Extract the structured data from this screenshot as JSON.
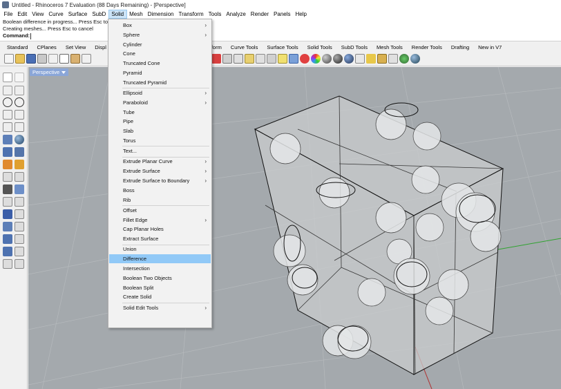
{
  "window": {
    "title": "Untitled - Rhinoceros 7 Evaluation (88 Days Remaining) - [Perspective]"
  },
  "menubar": {
    "items": [
      "File",
      "Edit",
      "View",
      "Curve",
      "Surface",
      "SubD",
      "Solid",
      "Mesh",
      "Dimension",
      "Transform",
      "Tools",
      "Analyze",
      "Render",
      "Panels",
      "Help"
    ],
    "active": "Solid"
  },
  "command": {
    "history": [
      "Boolean difference in progress... Press Esc to cancel",
      "Creating meshes... Press Esc to cancel"
    ],
    "prompt": "Command:"
  },
  "toolbar_tabs": [
    "Standard",
    "CPlanes",
    "Set View",
    "Displ",
    "Transform",
    "Curve Tools",
    "Surface Tools",
    "Solid Tools",
    "SubD Tools",
    "Mesh Tools",
    "Render Tools",
    "Drafting",
    "New in V7"
  ],
  "viewport": {
    "label": "Perspective",
    "background": "#a4a9ad"
  },
  "solid_menu": {
    "items": [
      {
        "label": "Box",
        "submenu": true
      },
      {
        "label": "Sphere",
        "submenu": true
      },
      {
        "label": "Cylinder",
        "submenu": false
      },
      {
        "label": "Cone",
        "submenu": false
      },
      {
        "label": "Truncated Cone",
        "submenu": false
      },
      {
        "label": "Pyramid",
        "submenu": false
      },
      {
        "label": "Truncated Pyramid",
        "submenu": false
      },
      {
        "label": "Ellipsoid",
        "submenu": true
      },
      {
        "label": "Paraboloid",
        "submenu": true
      },
      {
        "label": "Tube",
        "submenu": false
      },
      {
        "label": "Pipe",
        "submenu": false
      },
      {
        "label": "Slab",
        "submenu": false
      },
      {
        "label": "Torus",
        "submenu": false
      },
      {
        "label": "Text...",
        "submenu": false
      },
      {
        "label": "Extrude Planar Curve",
        "submenu": true
      },
      {
        "label": "Extrude Surface",
        "submenu": true
      },
      {
        "label": "Extrude Surface to Boundary",
        "submenu": true
      },
      {
        "label": "Boss",
        "submenu": false
      },
      {
        "label": "Rib",
        "submenu": false
      },
      {
        "label": "Offset",
        "submenu": false
      },
      {
        "label": "Fillet Edge",
        "submenu": true
      },
      {
        "label": "Cap Planar Holes",
        "submenu": false
      },
      {
        "label": "Extract Surface",
        "submenu": false
      },
      {
        "label": "Union",
        "submenu": false
      },
      {
        "label": "Difference",
        "submenu": false
      },
      {
        "label": "Intersection",
        "submenu": false
      },
      {
        "label": "Boolean Two Objects",
        "submenu": false
      },
      {
        "label": "Boolean Split",
        "submenu": false
      },
      {
        "label": "Create Solid",
        "submenu": false
      },
      {
        "label": "Solid Edit Tools",
        "submenu": true
      }
    ],
    "highlighted": "Difference",
    "submenu_arrow": "›"
  },
  "colors": {
    "menu_highlight": "#91c9f7",
    "viewport_label": "#8aa6d8",
    "axis_green": "#2fa32f",
    "axis_red": "#b03030"
  }
}
